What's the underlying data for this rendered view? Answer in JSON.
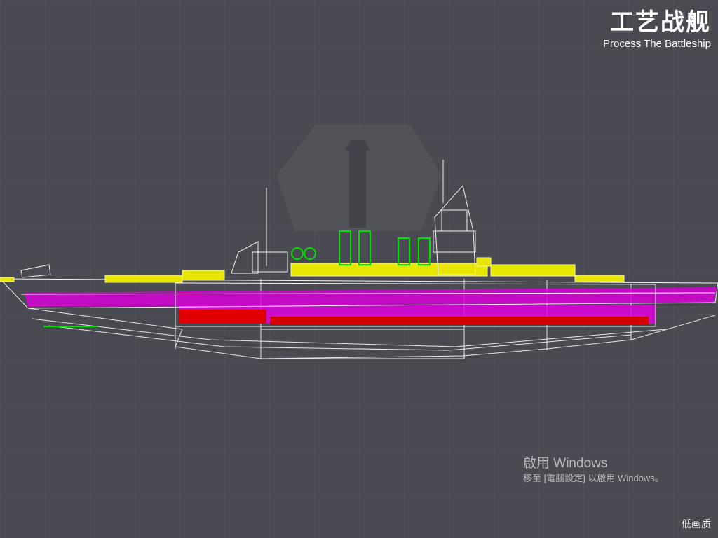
{
  "brand": {
    "title": "工艺战舰",
    "subtitle": "Process The Battleship"
  },
  "activation": {
    "title": "啟用 Windows",
    "message": "移至 [電腦設定] 以啟用 Windows。"
  },
  "quality_toggle": "低画质",
  "colors": {
    "background": "#4a4b52",
    "wireframe": "#ffffff",
    "superstructure": "#e8e800",
    "hull_band": "#e000e0",
    "armor_band": "#e00000",
    "funnels": "#00e000"
  }
}
